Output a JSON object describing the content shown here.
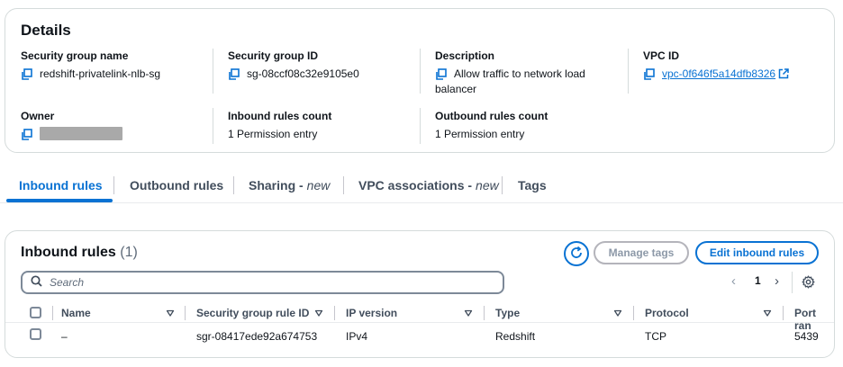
{
  "details": {
    "title": "Details",
    "fields": {
      "sg_name": {
        "label": "Security group name",
        "value": "redshift-privatelink-nlb-sg"
      },
      "sg_id": {
        "label": "Security group ID",
        "value": "sg-08ccf08c32e9105e0"
      },
      "description": {
        "label": "Description",
        "value_line1": "Allow traffic to network load",
        "value_line2": "balancer"
      },
      "vpc_id": {
        "label": "VPC ID",
        "value": "vpc-0f646f5a14dfb8326"
      },
      "owner": {
        "label": "Owner",
        "value": ""
      },
      "inbound_count": {
        "label": "Inbound rules count",
        "value": "1 Permission entry"
      },
      "outbound_count": {
        "label": "Outbound rules count",
        "value": "1 Permission entry"
      }
    }
  },
  "tabs": [
    {
      "label": "Inbound rules",
      "suffix": "",
      "active": true
    },
    {
      "label": "Outbound rules",
      "suffix": "",
      "active": false
    },
    {
      "label": "Sharing -",
      "suffix": "new",
      "active": false
    },
    {
      "label": "VPC associations -",
      "suffix": "new",
      "active": false
    },
    {
      "label": "Tags",
      "suffix": "",
      "active": false
    }
  ],
  "inbound": {
    "title": "Inbound rules",
    "count": "(1)",
    "manage_tags": "Manage tags",
    "edit_rules": "Edit inbound rules",
    "search_placeholder": "Search",
    "page": "1",
    "columns": [
      "Name",
      "Security group rule ID",
      "IP version",
      "Type",
      "Protocol",
      "Port ran"
    ],
    "rows": [
      {
        "name": "–",
        "rule_id": "sgr-08417ede92a674753",
        "ip_version": "IPv4",
        "type": "Redshift",
        "protocol": "TCP",
        "port": "5439"
      }
    ]
  },
  "colors": {
    "accent": "#0972d3",
    "text": "#0f141a",
    "border": "#d5dbdb"
  },
  "icons": [
    "copy-icon",
    "external-link-icon",
    "refresh-icon",
    "search-icon",
    "chevron-left-icon",
    "chevron-right-icon",
    "gear-icon",
    "sort-down-icon"
  ]
}
